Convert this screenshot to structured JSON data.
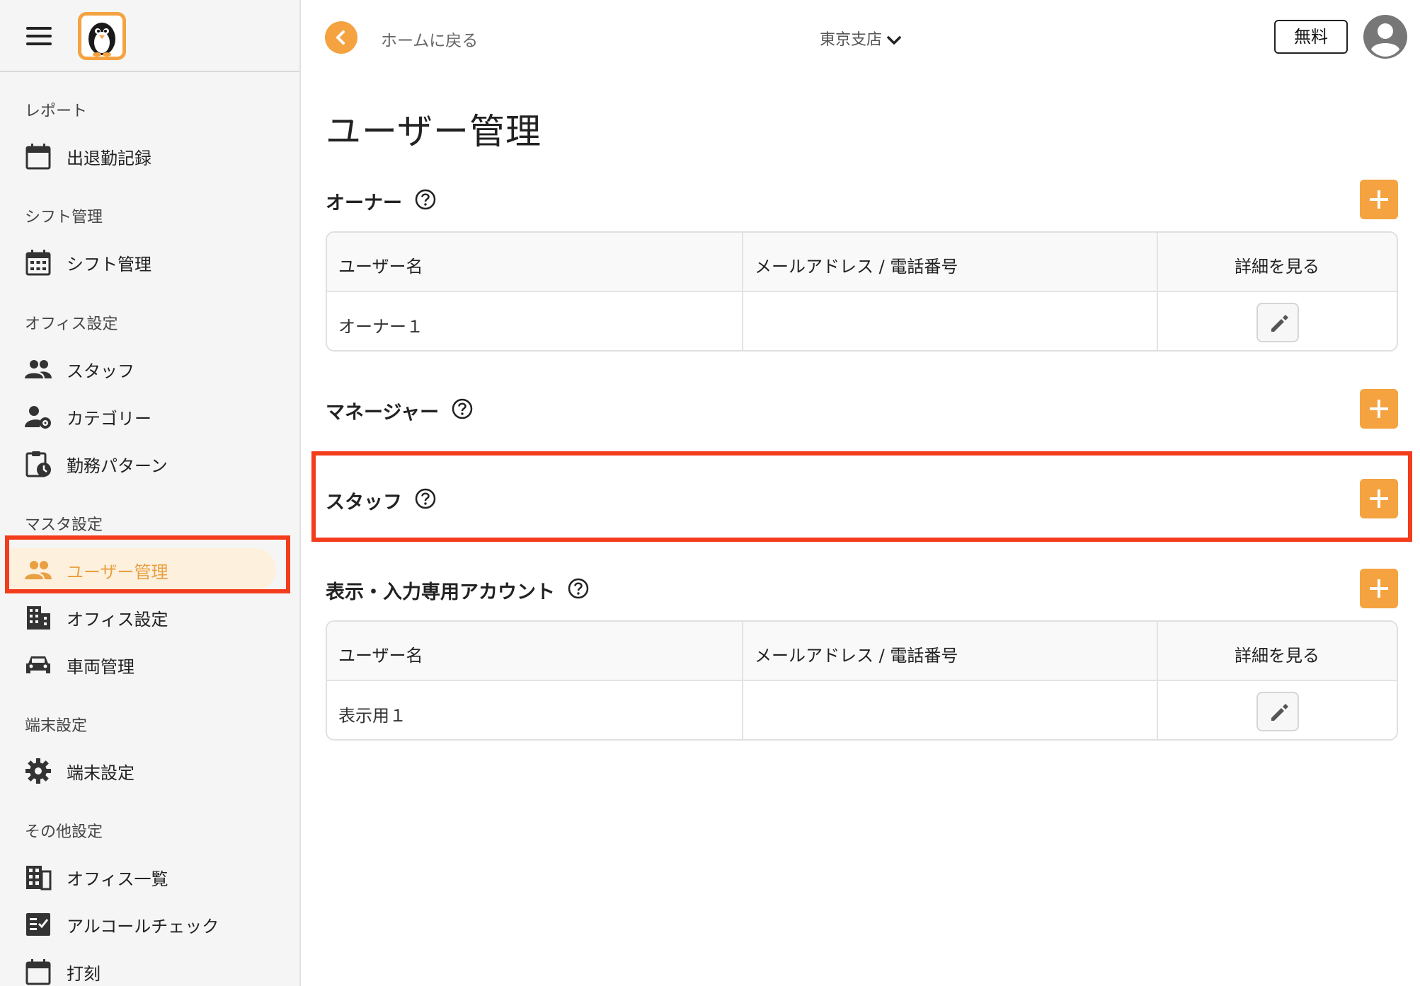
{
  "sidebar": {
    "sections": [
      {
        "label": "レポート",
        "items": [
          {
            "label": "出退勤記録",
            "icon": "calendar-icon"
          }
        ]
      },
      {
        "label": "シフト管理",
        "items": [
          {
            "label": "シフト管理",
            "icon": "calendar-grid-icon"
          }
        ]
      },
      {
        "label": "オフィス設定",
        "items": [
          {
            "label": "スタッフ",
            "icon": "people-icon"
          },
          {
            "label": "カテゴリー",
            "icon": "person-gear-icon"
          },
          {
            "label": "勤務パターン",
            "icon": "clipboard-clock-icon"
          }
        ]
      },
      {
        "label": "マスタ設定",
        "items": [
          {
            "label": "ユーザー管理",
            "icon": "people-icon",
            "active": true
          },
          {
            "label": "オフィス設定",
            "icon": "building-icon"
          },
          {
            "label": "車両管理",
            "icon": "car-icon"
          }
        ]
      },
      {
        "label": "端末設定",
        "items": [
          {
            "label": "端末設定",
            "icon": "gear-icon"
          }
        ]
      },
      {
        "label": "その他設定",
        "items": [
          {
            "label": "オフィス一覧",
            "icon": "office-list-icon"
          },
          {
            "label": "アルコールチェック",
            "icon": "checklist-icon"
          },
          {
            "label": "打刻",
            "icon": "calendar-icon"
          }
        ]
      }
    ]
  },
  "topbar": {
    "back_label": "ホームに戻る",
    "store": "東京支店",
    "plan_badge": "無料"
  },
  "page": {
    "title": "ユーザー管理",
    "groups": [
      {
        "title": "オーナー",
        "table": {
          "headers": [
            "ユーザー名",
            "メールアドレス / 電話番号",
            "詳細を見る"
          ],
          "rows": [
            {
              "name": "オーナー１",
              "contact": ""
            }
          ]
        }
      },
      {
        "title": "マネージャー"
      },
      {
        "title": "スタッフ"
      },
      {
        "title": "表示・入力専用アカウント",
        "table": {
          "headers": [
            "ユーザー名",
            "メールアドレス / 電話番号",
            "詳細を見る"
          ],
          "rows": [
            {
              "name": "表示用１",
              "contact": ""
            }
          ]
        }
      }
    ]
  },
  "colors": {
    "accent": "#f4a340",
    "active_bg": "#fdf0dd",
    "highlight": "#f23c1c"
  }
}
